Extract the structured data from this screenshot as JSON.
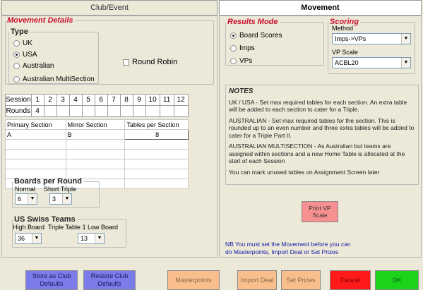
{
  "tabs": {
    "left": "Club/Event",
    "right": "Movement"
  },
  "movement_details": {
    "legend": "Movement Details",
    "type_legend": "Type",
    "type_options": [
      "UK",
      "USA",
      "Australian",
      "Australian MultiSection"
    ],
    "type_selected": "USA",
    "round_robin_label": "Round Robin",
    "round_robin_checked": false
  },
  "session_table": {
    "session_label": "Session",
    "rounds_label": "Rounds",
    "sessions": [
      "1",
      "2",
      "3",
      "4",
      "5",
      "6",
      "7",
      "8",
      "9",
      "10",
      "11",
      "12"
    ],
    "rounds": [
      "4",
      "",
      "",
      "",
      "",
      "",
      "",
      "",
      "",
      "",
      "",
      ""
    ]
  },
  "sections_table": {
    "headers": [
      "Primary Section",
      "Mirror Section",
      "Tables per Section"
    ],
    "rows": [
      [
        "A",
        "B",
        "8"
      ],
      [
        "",
        "",
        ""
      ],
      [
        "",
        "",
        ""
      ],
      [
        "",
        "",
        ""
      ],
      [
        "",
        "",
        ""
      ],
      [
        "",
        "",
        ""
      ]
    ]
  },
  "boards_per_round": {
    "legend": "Boards per Round",
    "normal_label": "Normal",
    "short_triple_label": "Short Triple",
    "normal_value": "6",
    "short_triple_value": "3"
  },
  "us_swiss": {
    "legend": "US Swiss Teams",
    "high_board_label": "High Board",
    "triple_low_label": "Triple Table 1 Low Board",
    "high_board_value": "36",
    "triple_low_value": "13"
  },
  "results_mode": {
    "legend": "Results Mode",
    "options": [
      "Board Scores",
      "Imps",
      "VPs"
    ],
    "selected": "Board Scores"
  },
  "scoring": {
    "legend": "Scoring",
    "method_label": "Method",
    "method_value": "Imps->VPs",
    "vp_scale_label": "VP Scale",
    "vp_scale_value": "ACBL20"
  },
  "notes": {
    "title": "NOTES",
    "paragraphs": [
      "UK / USA - Set max required tables for each section. An extra table will be added to each section to cater for a Triple.",
      "AUSTRALIAN - Set max required tables for the section. This is rounded up to an even number and three extra tables will be added to cater for a Triple Part II.",
      "AUSTRALIAN MULTISECTION - As Australian but teams are assigned within sections and a new Home Table is allocated at the start of each Session",
      "You can mark unused tables on Assignment Screen later"
    ]
  },
  "print_vp_label": "Print VP Scale",
  "nb_line1": "NB You must set the Movement before you can",
  "nb_line2": "do Masterpoints, Import Deal or Set Prizes",
  "buttons": {
    "store": "Store as Club Defaults",
    "restore": "Restore Club Defaults",
    "masterpoints": "Masterpoints",
    "import_deal": "Import Deal",
    "set_prizes": "Set Prizes",
    "cancel": "Cancel",
    "ok": "OK"
  },
  "colors": {
    "store_bg": "#7b7bea",
    "restore_bg": "#7b7bea",
    "orange_bg": "#f8be8c",
    "cancel_bg": "#ff1a1a",
    "ok_bg": "#1bd31b",
    "print_vp_bg": "#f79090"
  }
}
